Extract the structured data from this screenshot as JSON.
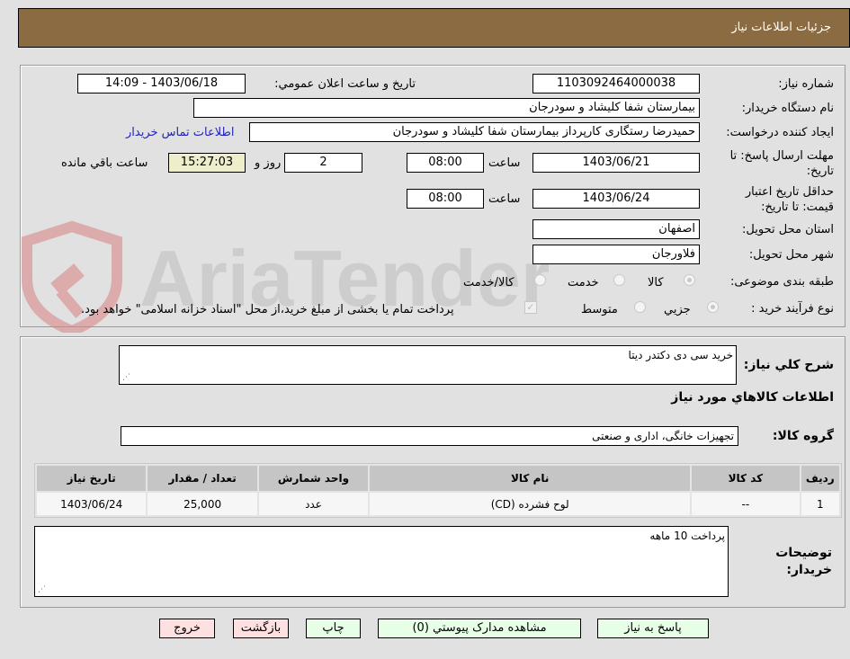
{
  "header": {
    "title": "جزئيات اطلاعات نياز"
  },
  "details": {
    "need_number": {
      "label": "شماره نیاز:",
      "value": "1103092464000038"
    },
    "announce_datetime": {
      "label": "تاريخ و ساعت اعلان عمومي:",
      "value": "1403/06/18 - 14:09"
    },
    "buyer_org": {
      "label": "نام دستگاه خریدار:",
      "value": "بیمارستان شفا کلیشاد و سودرجان"
    },
    "requester": {
      "label": "ایجاد کننده درخواست:",
      "value": "حمیدرضا رستگاری کارپرداز بیمارستان شفا کلیشاد و سودرجان"
    },
    "buyer_contact_link": "اطلاعات تماس خریدار",
    "response_deadline": {
      "label": "مهلت ارسال پاسخ: تا تاریخ:",
      "date": "1403/06/21",
      "time_label": "ساعت",
      "time": "08:00",
      "days": "2",
      "days_label": "روز و",
      "remaining_time": "15:27:03",
      "remaining_label": "ساعت باقي مانده"
    },
    "price_validity": {
      "label": "حداقل تاریخ اعتبار قیمت: تا تاریخ:",
      "date": "1403/06/24",
      "time_label": "ساعت",
      "time": "08:00"
    },
    "province": {
      "label": "استان محل تحویل:",
      "value": "اصفهان"
    },
    "city": {
      "label": "شهر محل تحویل:",
      "value": "فلاورجان"
    },
    "category": {
      "label": "طبقه بندی موضوعی:",
      "options": [
        "کالا",
        "خدمت",
        "کالا/خدمت"
      ],
      "selected": "کالا"
    },
    "purchase_process": {
      "label": "نوع فرآیند خرید :",
      "options": [
        "جزيي",
        "متوسط"
      ],
      "selected": "جزيي",
      "treasury_note": "پرداخت تمام یا بخشی از مبلغ خرید،از محل \"اسناد خزانه اسلامی\" خواهد بود."
    }
  },
  "needs": {
    "description_label": "شرح كلي نياز:",
    "description": "خرید سی دی دکتدر دیتا",
    "goods_info_title": "اطلاعات كالاهاي مورد نياز",
    "goods_group_label": "گروه کالا:",
    "goods_group": "تجهیزات خانگی، اداری و صنعتی",
    "table": {
      "headers": [
        "ردیف",
        "کد کالا",
        "نام کالا",
        "واحد شمارش",
        "تعداد / مقدار",
        "تاریخ نیاز"
      ],
      "rows": [
        [
          "1",
          "--",
          "لوح فشرده (CD)",
          "عدد",
          "25,000",
          "1403/06/24"
        ]
      ]
    },
    "buyer_notes_label": "توضیحات خریدار:",
    "buyer_notes": "پرداخت 10 ماهه"
  },
  "buttons": {
    "reply": "پاسخ به نياز",
    "attachments": "مشاهده مدارک پيوستي (0)",
    "print": "چاپ",
    "back": "بازگشت",
    "exit": "خروج"
  },
  "watermark": {
    "text": "AriaTender.neT"
  }
}
